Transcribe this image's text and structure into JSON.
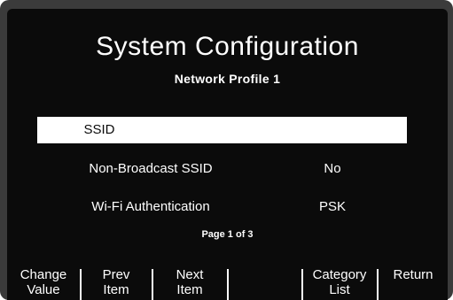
{
  "header": {
    "title": "System Configuration",
    "subtitle": "Network Profile 1"
  },
  "rows": [
    {
      "label": "SSID",
      "value": "",
      "selected": true
    },
    {
      "label": "Non-Broadcast SSID",
      "value": "No",
      "selected": false
    },
    {
      "label": "Wi-Fi Authentication",
      "value": "PSK",
      "selected": false
    }
  ],
  "page_indicator": "Page 1 of 3",
  "softkeys": [
    {
      "line1": "Change",
      "line2": "Value"
    },
    {
      "line1": "Prev",
      "line2": "Item"
    },
    {
      "line1": "Next",
      "line2": "Item"
    },
    {
      "line1": "",
      "line2": ""
    },
    {
      "line1": "Category",
      "line2": "List"
    },
    {
      "line1": "Return",
      "line2": ""
    }
  ],
  "colors": {
    "screen_background": "#0b0b0b",
    "bezel": "#3b3b3b",
    "text": "#ffffff",
    "highlight_background": "#ffffff",
    "highlight_text": "#0b0b0b"
  }
}
